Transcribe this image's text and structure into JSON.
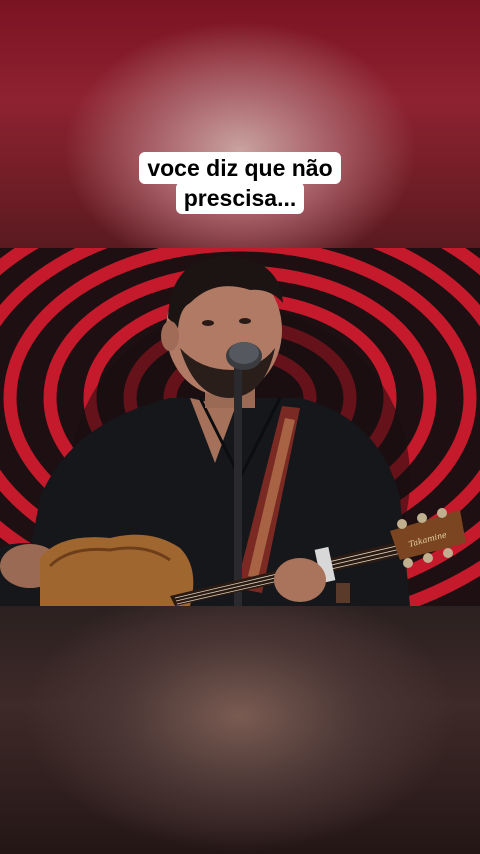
{
  "caption": {
    "line1": "voce diz que não",
    "line2": "prescisa..."
  },
  "guitar_brand": "Takamine",
  "colors": {
    "stripe_red": "#c41a2c",
    "stripe_dark": "#1e1012",
    "shirt": "#15171b",
    "guitar_body": "#a0662f"
  }
}
